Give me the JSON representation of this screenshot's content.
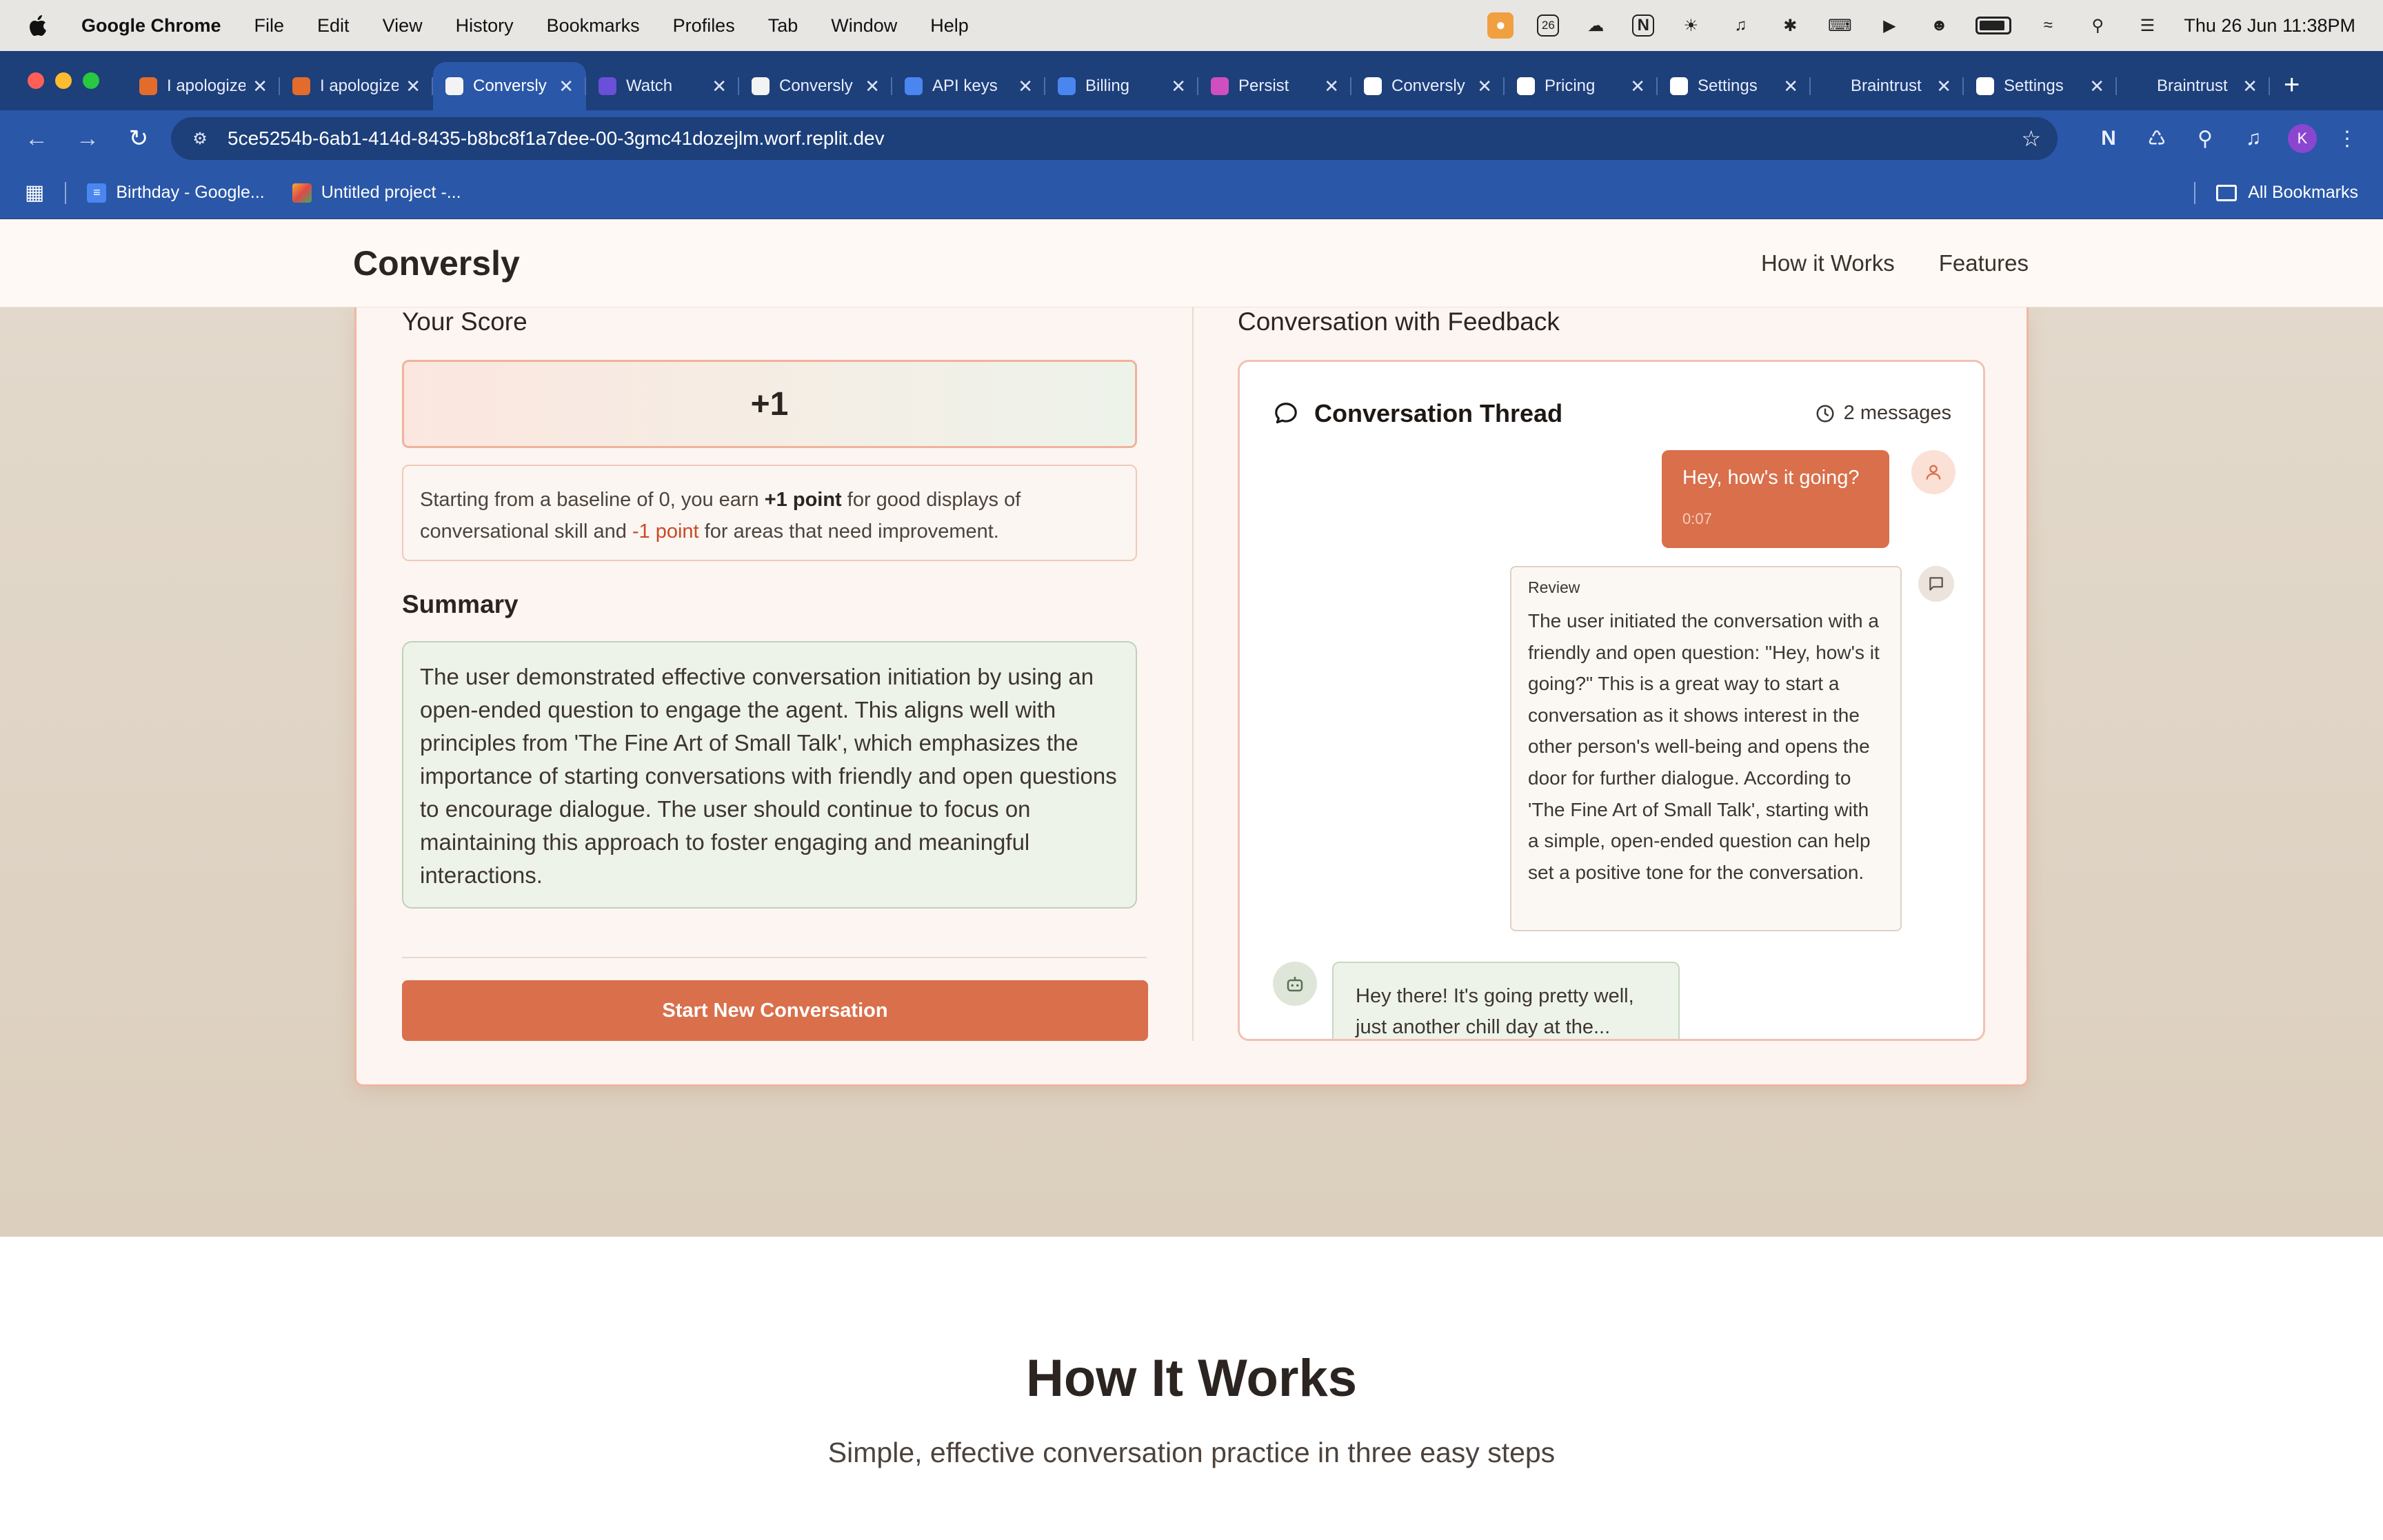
{
  "menubar": {
    "app": "Google Chrome",
    "items": [
      "File",
      "Edit",
      "View",
      "History",
      "Bookmarks",
      "Profiles",
      "Tab",
      "Window",
      "Help"
    ],
    "clock": "Thu 26 Jun  11:38PM",
    "calendar_day": "26"
  },
  "tabs": [
    {
      "label": "I apologize",
      "favicon_color": "#e36b2c",
      "active": false
    },
    {
      "label": "I apologize",
      "favicon_color": "#e36b2c",
      "active": false
    },
    {
      "label": "Conversly",
      "favicon_color": "#f3f3f3",
      "active": true
    },
    {
      "label": "Watch",
      "favicon_color": "#6a4fd8",
      "active": false
    },
    {
      "label": "Conversly",
      "favicon_color": "#f3f3f3",
      "active": false
    },
    {
      "label": "API keys",
      "favicon_color": "#4a86f0",
      "active": false
    },
    {
      "label": "Billing",
      "favicon_color": "#4a86f0",
      "active": false
    },
    {
      "label": "Persist",
      "favicon_color": "#d04fc0",
      "active": false
    },
    {
      "label": "Conversly",
      "favicon_color": "#ffffff",
      "active": false
    },
    {
      "label": "Pricing",
      "favicon_color": "#ffffff",
      "active": false
    },
    {
      "label": "Settings",
      "favicon_color": "#ffffff",
      "active": false
    },
    {
      "label": "Braintrust",
      "favicon_color": "#1d3f7a",
      "active": false
    },
    {
      "label": "Settings",
      "favicon_color": "#ffffff",
      "active": false
    },
    {
      "label": "Braintrust",
      "favicon_color": "#1d3f7a",
      "active": false
    }
  ],
  "address_bar": {
    "url": "5ce5254b-6ab1-414d-8435-b8bc8f1a7dee-00-3gmc41dozejlm.worf.replit.dev"
  },
  "profile_initial": "K",
  "bookmarks": {
    "items": [
      {
        "label": "Birthday - Google...",
        "icon": "docs-icon"
      },
      {
        "label": "Untitled project -...",
        "icon": "project-icon"
      }
    ],
    "all_label": "All Bookmarks"
  },
  "site": {
    "brand": "Conversly",
    "nav": [
      "How it Works",
      "Features"
    ]
  },
  "score": {
    "heading": "Your Score",
    "value": "+1",
    "baseline_pre": "Starting from a baseline of 0, you earn ",
    "plus_point": "+1 point",
    "baseline_mid": " for good displays of conversational skill and ",
    "minus_point": "-1 point",
    "baseline_post": " for areas that need improvement."
  },
  "summary": {
    "heading": "Summary",
    "text": "The user demonstrated effective conversation initiation by using an open-ended question to engage the agent. This aligns well with principles from 'The Fine Art of Small Talk', which emphasizes the importance of starting conversations with friendly and open questions to encourage dialogue. The user should continue to focus on maintaining this approach to foster engaging and meaningful interactions."
  },
  "start_button": "Start New Conversation",
  "conversation": {
    "heading": "Conversation with Feedback",
    "thread_title": "Conversation Thread",
    "message_count": "2 messages",
    "user_message": {
      "text": "Hey, how's it going?",
      "time": "0:07"
    },
    "review": {
      "label": "Review",
      "text": "The user initiated the conversation with a friendly and open question: \"Hey, how's it going?\" This is a great way to start a conversation as it shows interest in the other person's well-being and opens the door for further dialogue. According to 'The Fine Art of Small Talk', starting with a simple, open-ended question can help set a positive tone for the conversation."
    },
    "agent_message": "Hey there! It's going pretty well, just another chill day at the..."
  },
  "how_it_works": {
    "title": "How It Works",
    "subtitle": "Simple, effective conversation practice in three easy steps"
  },
  "colors": {
    "accent": "#d96f4b",
    "chrome_blue": "#2a57a8",
    "summary_green": "#eef3ea"
  }
}
